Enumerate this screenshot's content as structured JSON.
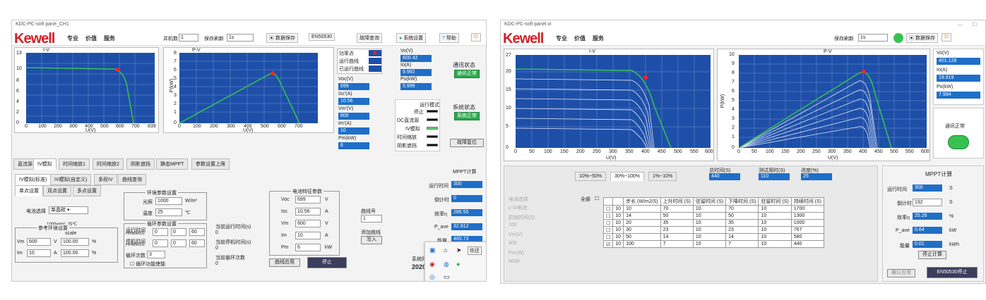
{
  "left": {
    "title": "KDC-PC-soft pane_CH1",
    "logo": "Kewell",
    "nav": [
      "专业",
      "价值",
      "服务"
    ],
    "toolbar": {
      "count_label": "并机数",
      "count_value": "1",
      "refresh_label": "保存刷新",
      "refresh_value": "1s",
      "save": "数据保存",
      "standard": "EN50530",
      "fault": "故障查询",
      "settings": "系统设置",
      "help": "帮助"
    },
    "iv_chart": {
      "title": "I-V",
      "xlabel": "U(V)",
      "xticks": [
        "0",
        "100",
        "200",
        "300",
        "400",
        "500",
        "600",
        "700",
        "839"
      ],
      "yticks": [
        "0",
        "2",
        "4",
        "6",
        "8",
        "10",
        "13"
      ]
    },
    "pv_chart": {
      "title": "P-V",
      "xlabel": "U(V)",
      "ylabel": "P(kW)",
      "xticks": [
        "0",
        "100",
        "200",
        "300",
        "400",
        "500",
        "600",
        "700"
      ],
      "yticks": [
        "0",
        "1",
        "2",
        "3",
        "4",
        "5",
        "6",
        "7",
        "8"
      ]
    },
    "legend": [
      "功率点",
      "运行曲线",
      "已运行曲线"
    ],
    "readouts": [
      {
        "label": "Voc(V)",
        "value": "699"
      },
      {
        "label": "Isc'(A)",
        "value": "10.56"
      },
      {
        "label": "Vm'(V)",
        "value": "600"
      },
      {
        "label": "Im'(A)",
        "value": "10"
      },
      {
        "label": "Pm(kW)",
        "value": "6"
      }
    ],
    "live": [
      {
        "label": "Vo(V)",
        "value": "600.42"
      },
      {
        "label": "Io(A)",
        "value": "9.992"
      },
      {
        "label": "Po(kW)",
        "value": "5.999"
      }
    ],
    "comm_status": "通讯状态",
    "comm_ok": "通讯正常",
    "sys_status": "系统状态",
    "sys_ok": "系统正常",
    "mode": {
      "title": "运行模式",
      "items": [
        "停止",
        "DC直流源",
        "IV模拟",
        "时间缩放",
        "阴影遮挡"
      ]
    },
    "fault_reset": "故障复位",
    "tabs": [
      "直流源",
      "IV模拟",
      "时间缩放1",
      "时间缩放2",
      "阴影遮挡",
      "静态MPPT",
      "参数设置上限"
    ],
    "subtabs": [
      "IV模拟(标准)",
      "IV模拟(自定义)",
      "多段IV",
      "曲线查询"
    ],
    "subtabs2": [
      "单点设置",
      "双点设置",
      "多点设置"
    ],
    "cell_select_label": "电池选择",
    "cell_select_value": "单晶硅",
    "ref_cond": "1000w/m², 25℃",
    "ref_title": "参考环境设置",
    "scale": "scale",
    "vm": {
      "label": "Vm",
      "value": "600",
      "unit": "V",
      "pct": "100.00",
      "pct_unit": "%"
    },
    "im": {
      "label": "Im",
      "value": "10",
      "unit": "A",
      "pct": "100.00",
      "pct_unit": "%"
    },
    "env": {
      "title": "环境参数设置",
      "light_label": "光照",
      "light_value": "1000",
      "light_unit": "W/m²",
      "temp_label": "温度",
      "temp_value": "25",
      "temp_unit": "℃"
    },
    "cycle": {
      "title": "循环参数设置",
      "run_label": "运行时间",
      "stop_label": "停机时间",
      "fmt": "HHMMSS",
      "h": "0",
      "m": "0",
      "s": "60",
      "count_label": "循环次数",
      "count_value": "3",
      "enable": "循环功能使能"
    },
    "current": {
      "run": "当前运行时间(s)",
      "stop": "当前停机时间(s)",
      "cycles": "当前循环次数",
      "run_val": "0",
      "stop_val": "0",
      "cycles_val": "0"
    },
    "battery": {
      "title": "电池特征参数",
      "rows": [
        {
          "label": "Voc",
          "value": "699",
          "unit": "V"
        },
        {
          "label": "Isc",
          "value": "10.56",
          "unit": "A"
        },
        {
          "label": "Vm",
          "value": "600",
          "unit": "V"
        },
        {
          "label": "Im",
          "value": "10",
          "unit": "A"
        },
        {
          "label": "Pm",
          "value": "6",
          "unit": "kW"
        }
      ]
    },
    "curve_no_label": "曲线号",
    "curve_no_value": "1",
    "add_curve": "添加曲线",
    "write": "写入",
    "apply": "曲线应用",
    "stop": "停止",
    "mppt": {
      "title": "MPPT计算",
      "rows": [
        {
          "label": "运行时间",
          "value": "300"
        },
        {
          "label": "倒计时",
          "value": "0"
        },
        {
          "label": "效率η",
          "value": "286.55"
        },
        {
          "label": "P_ave",
          "value": "32.912"
        },
        {
          "label": "能量",
          "value": "465.73"
        }
      ]
    },
    "sys_label": "系统时",
    "sys_value": "2020",
    "popup": "你还"
  },
  "right": {
    "title": "KDC-PC-soft panel.vi",
    "logo": "Kewell",
    "nav": [
      "专业",
      "价值",
      "服务"
    ],
    "toolbar": {
      "refresh_label": "保存刷新",
      "refresh_value": "1s",
      "save": "数据保存"
    },
    "iv_chart": {
      "title": "I-V",
      "xlabel": "U(V)",
      "xticks": [
        "0",
        "50",
        "100",
        "150",
        "200",
        "250",
        "300",
        "350",
        "400",
        "450",
        "500",
        "550",
        "600"
      ],
      "yticks": [
        "0",
        "5",
        "10",
        "15",
        "20",
        "27"
      ]
    },
    "pv_chart": {
      "title": "P-V",
      "xlabel": "U(V)",
      "ylabel": "P(kW)",
      "xticks": [
        "0",
        "50",
        "100",
        "150",
        "200",
        "250",
        "300",
        "350",
        "400",
        "450",
        "500",
        "550",
        "600"
      ],
      "yticks": [
        "0",
        "1",
        "2",
        "3",
        "4",
        "5",
        "6",
        "7",
        "8",
        "9",
        "10"
      ]
    },
    "live": [
      {
        "label": "Vo(V)",
        "value": "401.128"
      },
      {
        "label": "Io(A)",
        "value": "19.919"
      },
      {
        "label": "Po(kW)",
        "value": "7.994"
      }
    ],
    "comm_ok": "通讯正常",
    "tabs": [
      "10%~50%",
      "30%~100%",
      "1%~10%"
    ],
    "summary": [
      {
        "label": "总时间(S)",
        "value": "440"
      },
      {
        "label": "测试用时(S)",
        "value": "110"
      },
      {
        "label": "进度(%)",
        "value": "25"
      }
    ],
    "side": [
      "电池选择",
      "c-Si电池",
      "初始时间(S)",
      "100",
      "Vm(V)",
      "400",
      "Pm(W)",
      "8000"
    ],
    "all_label": "全部",
    "table_headers": [
      "",
      "步长 (W/m2/S)",
      "上升时间 (S)",
      "驻留时间 (S)",
      "下降时间 (S)",
      "驻留时间 (S)",
      "持续时间 (S)"
    ],
    "table_rows": [
      [
        "10",
        "10",
        "70",
        "10",
        "70",
        "10",
        "1700"
      ],
      [
        "10",
        "14",
        "50",
        "10",
        "50",
        "10",
        "1300"
      ],
      [
        "10",
        "20",
        "35",
        "10",
        "35",
        "10",
        "1000"
      ],
      [
        "10",
        "30",
        "23",
        "10",
        "23",
        "10",
        "767"
      ],
      [
        "10",
        "50",
        "14",
        "10",
        "14",
        "10",
        "580"
      ],
      [
        "10",
        "100",
        "7",
        "10",
        "7",
        "10",
        "440"
      ]
    ],
    "mppt": {
      "title": "MPPT计算",
      "rows": [
        {
          "label": "运行时间",
          "value": "300",
          "unit": "S"
        },
        {
          "label": "倒计时",
          "value": "192",
          "unit": "S"
        },
        {
          "label": "效率η",
          "value": "25.26",
          "unit": "%"
        },
        {
          "label": "P_ave",
          "value": "0.64",
          "unit": "kW"
        },
        {
          "label": "能量",
          "value": "0.01",
          "unit": "kWh"
        }
      ],
      "stop": "停止计算"
    },
    "confirm": "确认应用",
    "en_stop": "EN50530停止"
  },
  "colors": {
    "plot_bg": "#1e4fa8",
    "grid": "#6f8fcf",
    "curve_green": "#37c24f",
    "mpp_red": "#ff2020",
    "value_blue": "#1f6fc8",
    "brand_red": "#d41f26"
  }
}
